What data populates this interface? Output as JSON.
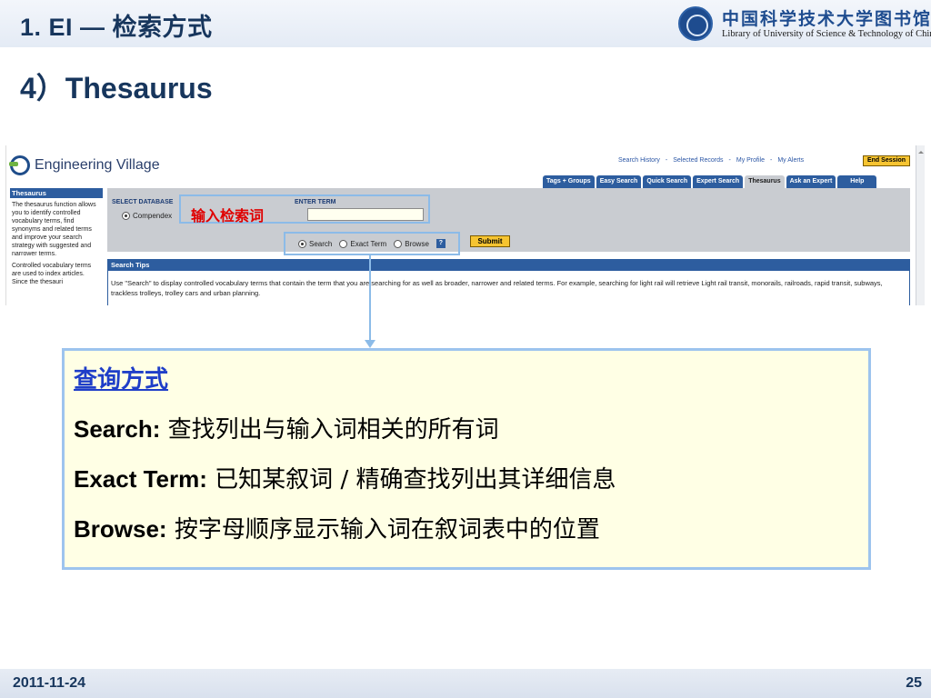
{
  "slide": {
    "title": "1. EI — 检索方式",
    "subtitle": "4）Thesaurus",
    "date": "2011-11-24",
    "page": "25"
  },
  "logo": {
    "chinese_name": "中国科学技术大学图书馆",
    "english_name": "Library of University of Science & Technology of China"
  },
  "ev": {
    "brand": "Engineering Village",
    "top_links": [
      "Search History",
      "-",
      "Selected Records",
      "-",
      "My Profile",
      "-",
      "My Alerts"
    ],
    "end_session": "End Session",
    "tabs": [
      {
        "label": "Tags + Groups",
        "active": false
      },
      {
        "label": "Easy Search",
        "active": false
      },
      {
        "label": "Quick Search",
        "active": false
      },
      {
        "label": "Expert Search",
        "active": false
      },
      {
        "label": "Thesaurus",
        "active": true
      },
      {
        "label": "Ask an Expert",
        "active": false
      },
      {
        "label": "Help",
        "active": false
      }
    ],
    "sidebar": {
      "heading": "Thesaurus",
      "para1": "The thesaurus function allows you to identify controlled vocabulary terms, find synonyms and related terms and improve your search strategy with suggested and narrower terms.",
      "para2": "Controlled vocabulary terms are used to index articles. Since the thesauri"
    },
    "form": {
      "select_database_label": "SELECT DATABASE",
      "database_option": "Compendex",
      "enter_term_label": "ENTER TERM",
      "term_value": "",
      "options": [
        {
          "label": "Search",
          "selected": true
        },
        {
          "label": "Exact Term",
          "selected": false
        },
        {
          "label": "Browse",
          "selected": false
        }
      ],
      "help_icon": "?",
      "submit_label": "Submit"
    },
    "tips": {
      "heading": "Search Tips",
      "text": "Use \"Search\" to display controlled vocabulary terms that contain the term that you are searching for as well as broader, narrower and related terms. For example, searching for light rail will retrieve Light rail transit, monorails, railroads, rapid transit, subways, trackless trolleys, trolley cars and urban planning."
    }
  },
  "annotation": {
    "input_label": "输入检索词"
  },
  "note": {
    "title": "查询方式",
    "lines": [
      {
        "key": "Search:",
        "value": " 查找列出与输入词相关的所有词"
      },
      {
        "key": "Exact Term:",
        "value": " 已知某叙词 / 精确查找列出其详细信息"
      },
      {
        "key": "Browse:",
        "value": " 按字母顺序显示输入词在叙词表中的位置"
      }
    ]
  },
  "colors": {
    "title_navy": "#17365d",
    "ev_blue": "#2d5d9f",
    "highlight_red": "#e00000",
    "callout_blue": "#8cbbe8",
    "note_bg": "#ffffe5",
    "note_title": "#1f3ec8",
    "button_gold": "#f6c431"
  }
}
